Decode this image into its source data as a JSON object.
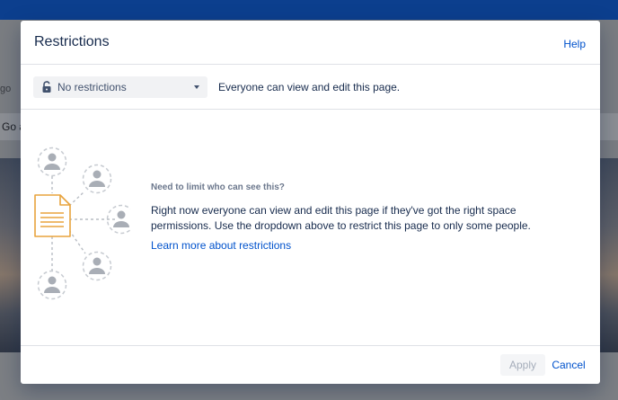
{
  "background": {
    "left_text_1": "go",
    "left_text_2": "Go a"
  },
  "dialog": {
    "title": "Restrictions",
    "help_label": "Help",
    "restriction_select": {
      "icon": "unlock-icon",
      "selected": "No restrictions"
    },
    "select_description": "Everyone can view and edit this page.",
    "info": {
      "heading": "Need to limit who can see this?",
      "body": "Right now everyone can view and edit this page if they've got the right space permissions. Use the dropdown above to restrict this page to only some people.",
      "learn_more": "Learn more about restrictions"
    },
    "footer": {
      "apply_label": "Apply",
      "cancel_label": "Cancel"
    }
  },
  "colors": {
    "header": "#0c3f8e",
    "link": "#0052cc",
    "text": "#172b4d",
    "document_outline": "#e8a33d"
  }
}
